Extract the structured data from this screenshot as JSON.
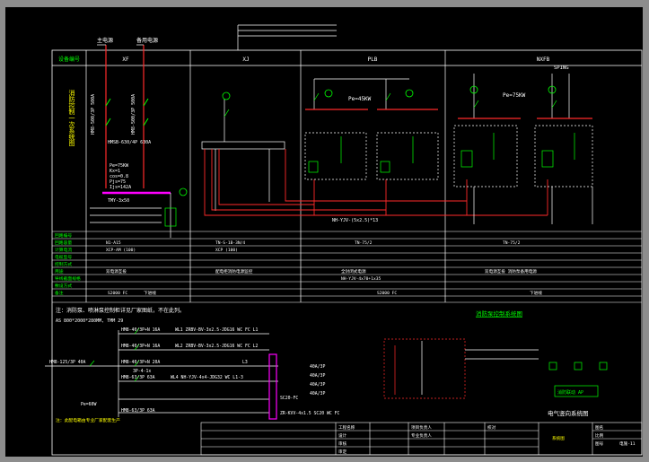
{
  "colors": {
    "background": "#8d8d8d",
    "paper": "#000000",
    "line": "#ffffff",
    "busbar": "#ff2a2a",
    "device": "#00ff00",
    "label": "#00ff00",
    "highlight": "#ff00ff",
    "frame": "#8080ff"
  },
  "header": {
    "row_label": "设备编号",
    "cabinets": [
      "XF",
      "XJ",
      "PLB",
      "NXFB"
    ],
    "side_title": "消防控制一次系统图",
    "source_main": "主电源",
    "source_backup": "备用电源",
    "source_right": "SPING"
  },
  "main_diagram": {
    "power_plb": "Pe=45KW",
    "power_nxfb": "Pe=75KW",
    "control_bus_label": "NH-YJV-(5x2.5)*13",
    "breaker_left": "HM8-500/3P 500A",
    "breaker_mid": "HM8-500/3P 500A",
    "ats": "HMSB-630/4P 630A",
    "ratings": "Pe=75KW\nKx=1\ncos=0.8\nPjs=75\nIjs=142A",
    "ct_label": "TMY-3x50"
  },
  "table": {
    "rows": [
      "回路编号",
      "回路容量",
      "计算电流",
      "电缆型号",
      "控制方式",
      "用途",
      "导线截面规格",
      "敷设方式",
      "备注"
    ],
    "col_values": [
      [
        "N1-A15",
        "TN-S-1B-3N/4",
        "TN-75/2",
        "TN-75/2"
      ],
      [
        "XCP-AM (100)",
        "XCP (100)",
        "",
        ""
      ],
      [
        "双电源互投",
        "配电柜消防电源监控",
        "全封闭式电源",
        "双电源互投 消防泵备用电源"
      ],
      [
        "NH-YJV-4x70+1x35",
        "",
        "",
        ""
      ],
      [
        "S2000 FC",
        "下进线",
        "S2000 FC",
        "下进线"
      ]
    ]
  },
  "note": "注：消防泵、喷淋泵控制柜详见厂家图纸，不在此列。",
  "sub_system": {
    "spec": "AS 800*2000*280MM, TMM 29",
    "feeder_1": "HM8-40/3P+N 16A",
    "feeder_1_cable": "WL1 ZRBV-BV-3x2.5-JDG16 WC FC  L1",
    "feeder_2": "HM8-40/3P+N 16A",
    "feeder_2_cable": "WL2 ZRBV-BV-3x2.5-JDG16 WC FC  L2",
    "feeder_3": "HM8-40/3P+N 20A",
    "feeder_3_cable": "L3",
    "feeder_4": "HM8-63/3P 63A",
    "feeder_4_cable": "WL4 NH-YJV-4x4-JDG32 WC  L1-3",
    "main_breaker": "HM8-125/3P 40A",
    "meter": "3P-4-1x",
    "power": "Pe=60W",
    "spare": "HM8-63/3P 63A",
    "incoming": "ZR-KVV-4x1.5 SC20 WC FC",
    "spare_cable": "SC20-FC",
    "label_1": "40A/3P",
    "label_2": "40A/3P",
    "label_3": "40A/3P",
    "label_4": "40A/3P",
    "footnote": "注：此配电箱由专业厂家配套生产"
  },
  "control_panel": {
    "title": "消防泵控制系统图",
    "box_label": "消防联动 AP"
  },
  "system_title": "电气竖向系统图",
  "title_block": {
    "labels": [
      "工程名称",
      "设计",
      "审核",
      "审定",
      "项目负责人",
      "专业负责人",
      "校对",
      "图名",
      "比例",
      "图号"
    ],
    "drawing_name": "系统图",
    "sheet_no": "电施-11"
  }
}
